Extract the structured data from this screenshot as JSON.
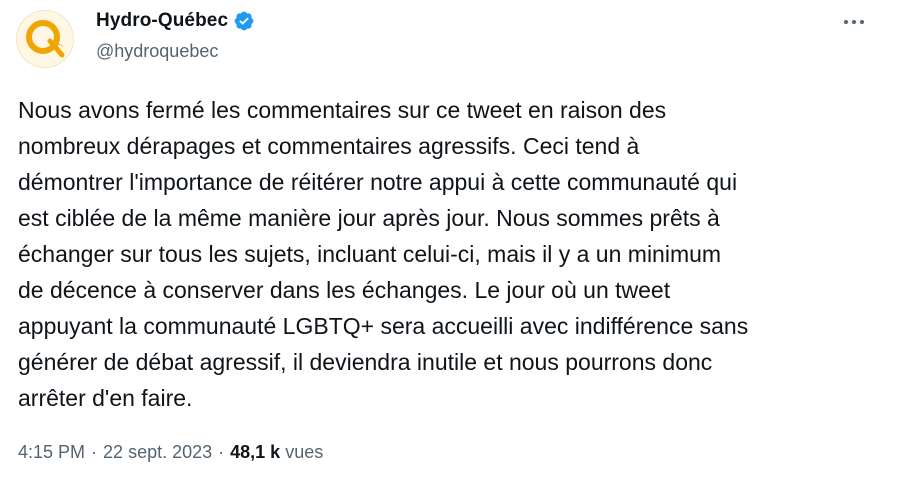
{
  "author": {
    "display_name": "Hydro-Québec",
    "handle": "@hydroquebec",
    "verified_icon": "verified-badge-icon",
    "brand_color": "#f0a500"
  },
  "tweet": {
    "lines": [
      "Nous avons fermé les commentaires sur ce tweet en raison des",
      "nombreux dérapages et commentaires agressifs. Ceci tend à",
      "démontrer l'importance de réitérer notre appui à cette communauté qui",
      "est ciblée de la même manière jour après jour. Nous sommes prêts à",
      "échanger sur tous les sujets, incluant celui-ci, mais il y a un minimum",
      "de décence à conserver dans les échanges. Le jour où un tweet",
      "appuyant la communauté LGBTQ+ sera accueilli avec indifférence sans",
      "générer de débat agressif, il deviendra inutile et nous pourrons donc",
      "arrêter d'en faire."
    ]
  },
  "meta": {
    "time": "4:15 PM",
    "separator": "·",
    "date": "22 sept. 2023",
    "views_count": "48,1 k",
    "views_label": "vues"
  },
  "colors": {
    "text_primary": "#0f1419",
    "text_secondary": "#536471",
    "verified_blue": "#1d9bf0"
  }
}
